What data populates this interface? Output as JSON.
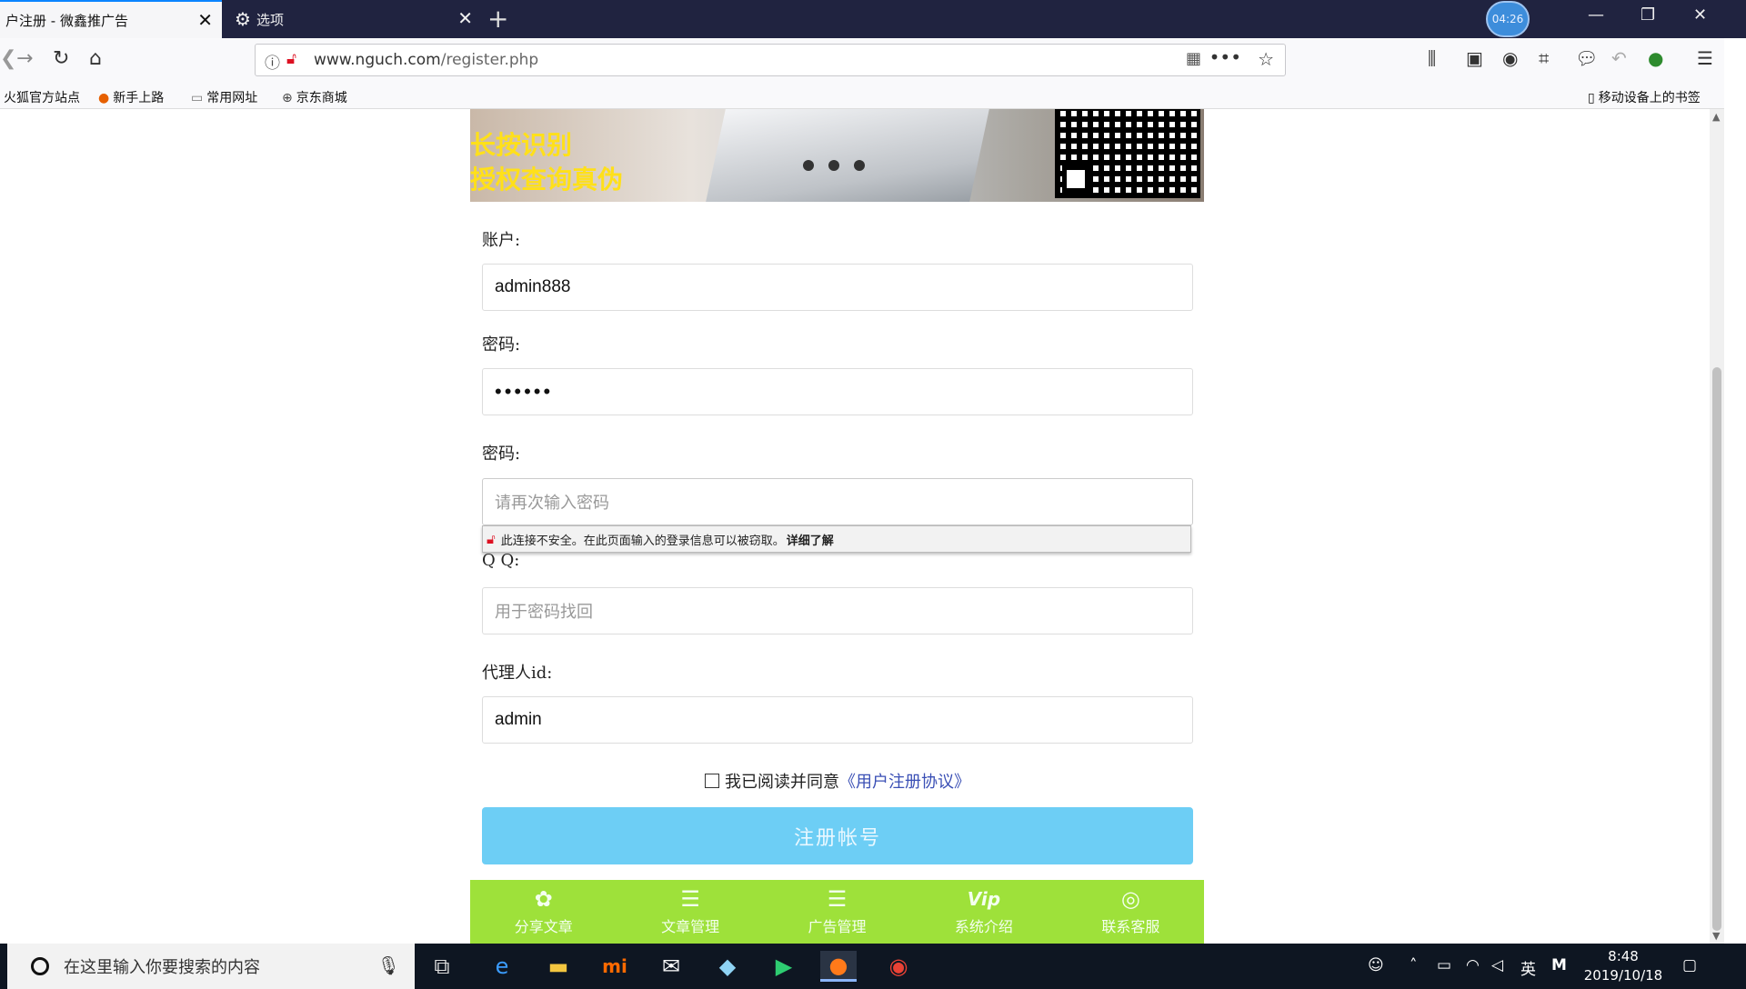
{
  "browser": {
    "tabs": [
      {
        "title": "户注册 - 微鑫推广告",
        "close": "✕"
      },
      {
        "title": "选项",
        "close": "✕"
      }
    ],
    "new_tab": "+",
    "timer": "04:26",
    "window_controls": {
      "minimize": "—",
      "restore": "❐",
      "close": "✕"
    },
    "url": {
      "domain": "www.nguch.com",
      "path": "/register.php"
    },
    "bookmarks": [
      {
        "label": "火狐官方站点",
        "icon": "firefox-icon"
      },
      {
        "label": "新手上路",
        "icon": "firefox-icon"
      },
      {
        "label": "常用网址",
        "icon": "folder-icon"
      },
      {
        "label": "京东商城",
        "icon": "globe-icon"
      }
    ],
    "mobile_bookmarks": "移动设备上的书签"
  },
  "banner": {
    "line1": "长按识别",
    "line2": "授权查询真伪"
  },
  "form": {
    "account_label": "账户:",
    "account_value": "admin888",
    "password_label": "密码:",
    "password_value": "••••••",
    "confirm_label": "密码:",
    "confirm_placeholder": "请再次输入密码",
    "insecure_warning": "此连接不安全。在此页面输入的登录信息可以被窃取。",
    "insecure_more": "详细了解",
    "qq_label": "Q Q:",
    "qq_placeholder": "用于密码找回",
    "agent_label": "代理人id:",
    "agent_value": "admin",
    "agree_text": "我已阅读并同意",
    "agree_link": "《用户注册协议》",
    "submit": "注册帐号"
  },
  "bottom_nav": [
    {
      "label": "分享文章",
      "icon": "share-icon"
    },
    {
      "label": "文章管理",
      "icon": "list-icon"
    },
    {
      "label": "广告管理",
      "icon": "list-icon"
    },
    {
      "label": "系统介绍",
      "icon": "vip-icon"
    },
    {
      "label": "联系客服",
      "icon": "service-icon"
    }
  ],
  "taskbar": {
    "search_placeholder": "在这里输入你要搜索的内容",
    "ime": "英",
    "time": "8:48",
    "date": "2019/10/18"
  }
}
